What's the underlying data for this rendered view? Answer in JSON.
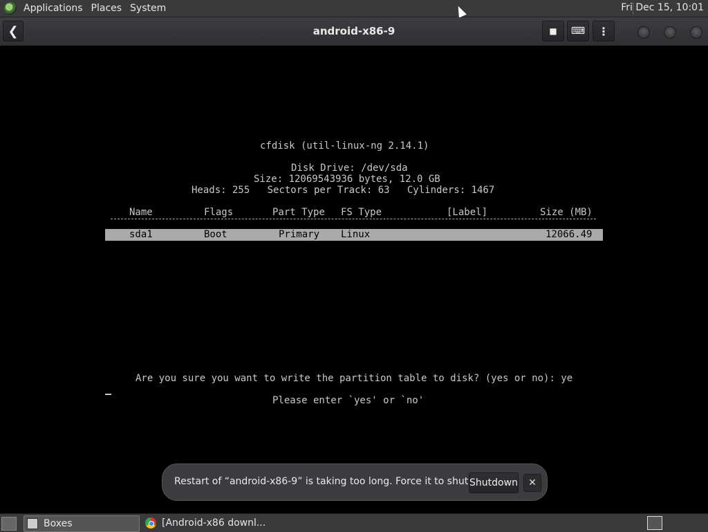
{
  "top_panel": {
    "menus": [
      "Applications",
      "Places",
      "System"
    ],
    "clock": "Fri Dec 15, 10:01"
  },
  "window": {
    "title": "android-x86-9",
    "back_icon": "back-arrow-icon",
    "stop_icon": "stop-icon",
    "keyboard_icon": "keyboard-icon",
    "menu_icon": "kebab-menu-icon"
  },
  "terminal": {
    "program": "cfdisk (util-linux-ng 2.14.1)",
    "disk_drive": "Disk Drive: /dev/sda",
    "size_line": "Size: 12069543936 bytes, 12.0 GB",
    "geometry_line": "Heads: 255   Sectors per Track: 63   Cylinders: 1467",
    "columns": {
      "name": "Name",
      "flags": "Flags",
      "part_type": "Part Type",
      "fs_type": "FS Type",
      "label": "[Label]",
      "size": "Size (MB)"
    },
    "partitions": [
      {
        "name": "sda1",
        "flags": "Boot",
        "part_type": "Primary",
        "fs_type": "Linux",
        "label": "",
        "size": "12066.49"
      }
    ],
    "prompt": "Are you sure you want to write the partition table to disk? (yes or no): ye",
    "hint": "Please enter `yes' or `no'"
  },
  "notification": {
    "message": "Restart of “android-x86-9” is taking too long. Force it to shutdown?",
    "shutdown_label": "Shutdown",
    "close_label": "✕"
  },
  "taskbar": {
    "tasks": [
      {
        "label": "Boxes",
        "icon": "boxes-icon"
      },
      {
        "label": "[Android-x86 downl...",
        "icon": "chrome-icon"
      }
    ]
  },
  "colors": {
    "panel_bg": "#3a3a3a",
    "terminal_fg": "#c8c8c8",
    "highlight_bg": "#aaaaaa"
  }
}
